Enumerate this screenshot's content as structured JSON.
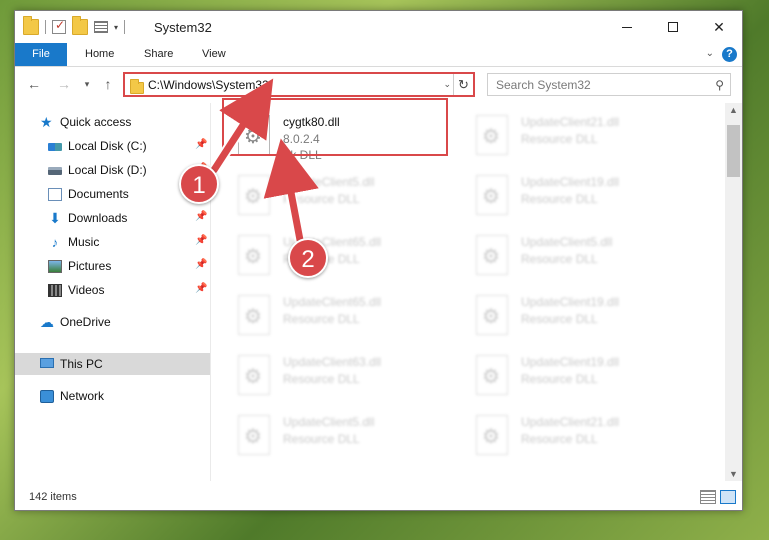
{
  "window": {
    "title": "System32",
    "controls": {
      "minimize": "─",
      "maximize": "☐",
      "close": "✕"
    }
  },
  "ribbon": {
    "tabs": [
      "File",
      "Home",
      "Share",
      "View"
    ],
    "help": "?"
  },
  "address_bar": {
    "path": "C:\\Windows\\System32",
    "search_placeholder": "Search System32"
  },
  "nav_pane": {
    "items": [
      {
        "label": "Quick access",
        "icon": "star-icon",
        "pinned": false
      },
      {
        "label": "Local Disk (C:)",
        "icon": "drive-icon",
        "pinned": true
      },
      {
        "label": "Local Disk (D:)",
        "icon": "drive-icon",
        "pinned": true
      },
      {
        "label": "Documents",
        "icon": "documents-icon",
        "pinned": true
      },
      {
        "label": "Downloads",
        "icon": "downloads-icon",
        "pinned": true
      },
      {
        "label": "Music",
        "icon": "music-icon",
        "pinned": true
      },
      {
        "label": "Pictures",
        "icon": "pictures-icon",
        "pinned": true
      },
      {
        "label": "Videos",
        "icon": "videos-icon",
        "pinned": true
      },
      {
        "label": "OneDrive",
        "icon": "cloud-icon",
        "pinned": false
      },
      {
        "label": "This PC",
        "icon": "computer-icon",
        "pinned": false,
        "selected": true
      },
      {
        "label": "Network",
        "icon": "network-icon",
        "pinned": false
      }
    ]
  },
  "files": {
    "highlighted": {
      "name": "cygtk80.dll",
      "version": "8.0.2.4",
      "description": "Tk DLL"
    },
    "left_column": [
      {
        "name": "UpdateClient5.dll",
        "description": "Resource DLL"
      },
      {
        "name": "UpdateClient65.dll",
        "description": "Resource DLL"
      },
      {
        "name": "UpdateClient65.dll",
        "description": "Resource DLL"
      },
      {
        "name": "UpdateClient63.dll",
        "description": "Resource DLL"
      },
      {
        "name": "UpdateClient5.dll",
        "description": "Resource DLL"
      }
    ],
    "right_column": [
      {
        "name": "UpdateClient21.dll",
        "description": "Resource DLL"
      },
      {
        "name": "UpdateClient19.dll",
        "description": "Resource DLL"
      },
      {
        "name": "UpdateClient5.dll",
        "description": "Resource DLL"
      },
      {
        "name": "UpdateClient19.dll",
        "description": "Resource DLL"
      },
      {
        "name": "UpdateClient19.dll",
        "description": "Resource DLL"
      },
      {
        "name": "UpdateClient21.dll",
        "description": "Resource DLL"
      }
    ]
  },
  "status_bar": {
    "item_count": "142 items"
  },
  "annotations": {
    "marker1": "1",
    "marker2": "2",
    "color": "#d9484a"
  },
  "colors": {
    "accent": "#1979ca",
    "highlight": "#d9484a"
  }
}
